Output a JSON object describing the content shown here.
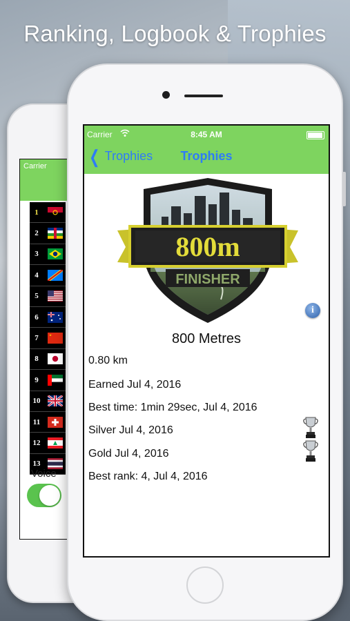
{
  "headline": "Ranking, Logbook & Trophies",
  "back_phone": {
    "carrier": "Carrier",
    "ranks": [
      {
        "n": "1"
      },
      {
        "n": "2"
      },
      {
        "n": "3"
      },
      {
        "n": "4"
      },
      {
        "n": "5"
      },
      {
        "n": "6"
      },
      {
        "n": "7"
      },
      {
        "n": "8"
      },
      {
        "n": "9"
      },
      {
        "n": "10"
      },
      {
        "n": "11"
      },
      {
        "n": "12"
      },
      {
        "n": "13"
      }
    ],
    "voice_label": "Voice",
    "voice_on": true
  },
  "status": {
    "carrier": "Carrier",
    "time": "8:45 AM"
  },
  "nav": {
    "back_label": "Trophies",
    "title": "Trophies"
  },
  "badge": {
    "distance_text": "800m",
    "finisher_text": "FINISHER"
  },
  "trophy": {
    "title": "800 Metres",
    "distance": "0.80 km",
    "earned": "Earned Jul 4, 2016",
    "best_time": "Best time: 1min 29sec, Jul 4, 2016",
    "silver": "Silver Jul 4, 2016",
    "gold": "Gold Jul 4, 2016",
    "best_rank": "Best rank: 4, Jul 4, 2016"
  },
  "icons": {
    "info": "info-icon",
    "silver_cup": "trophy-cup-icon",
    "gold_cup": "trophy-cup-icon"
  },
  "colors": {
    "navbar": "#7ed45f",
    "link": "#2e7cf6",
    "toggle_on": "#5ac34e"
  }
}
